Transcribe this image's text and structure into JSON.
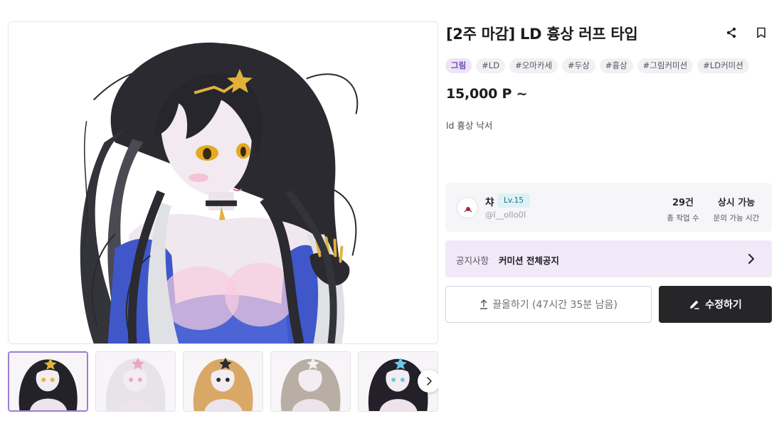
{
  "product": {
    "title": "[2주 마감] LD 흉상 러프 타입",
    "price": "15,000 P ~",
    "description": "ld 흉상 낙서"
  },
  "tags": [
    {
      "label": "그림",
      "primary": true
    },
    {
      "label": "#LD",
      "primary": false
    },
    {
      "label": "#오마카세",
      "primary": false
    },
    {
      "label": "#두상",
      "primary": false
    },
    {
      "label": "#흉상",
      "primary": false
    },
    {
      "label": "#그림커미션",
      "primary": false
    },
    {
      "label": "#LD커미션",
      "primary": false
    }
  ],
  "seller": {
    "name": "챠",
    "level": "Lv.15",
    "handle": "@l__ollo0l",
    "stats": [
      {
        "value": "29건",
        "label": "총 작업 수"
      },
      {
        "value": "상시 가능",
        "label": "문의 가능 시간"
      }
    ]
  },
  "notice": {
    "label": "공지사항",
    "title": "커미션 전체공지"
  },
  "actions": {
    "bump_label": "끌올하기 (47시간 35분 남음)",
    "edit_label": "수정하기"
  },
  "gallery": {
    "thumbnails": [
      {
        "icon": "artwork-thumbnail",
        "hair": "#222228",
        "accent": "#e0b23a",
        "active": true
      },
      {
        "icon": "artwork-thumbnail",
        "hair": "#e6e4e8",
        "accent": "#e9a7c0",
        "active": false
      },
      {
        "icon": "artwork-thumbnail",
        "hair": "#d9a866",
        "accent": "#2b2b30",
        "active": false
      },
      {
        "icon": "artwork-thumbnail",
        "hair": "#b9aea3",
        "accent": "#f2f2f2",
        "active": false
      },
      {
        "icon": "artwork-thumbnail",
        "hair": "#23202a",
        "accent": "#6dc6e8",
        "active": false
      }
    ]
  },
  "colors": {
    "accent": "#6e45b6",
    "notice_bg": "#f1e9f7",
    "primary_button": "#262629",
    "level_badge_bg": "#dcf2f6"
  }
}
